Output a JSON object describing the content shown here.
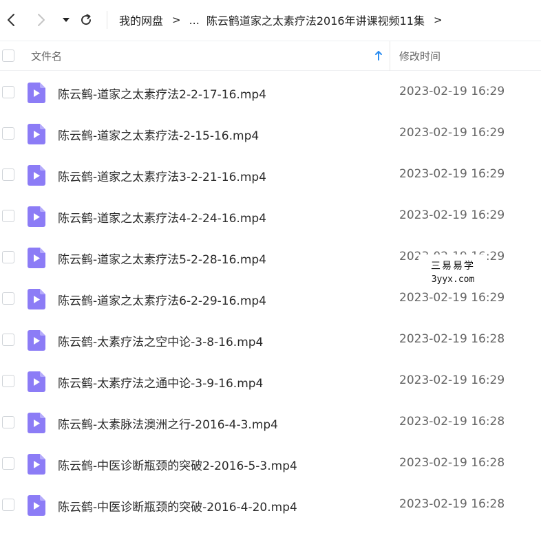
{
  "toolbar": {
    "back_icon": "chevron-left-icon",
    "forward_icon": "chevron-right-icon",
    "dropdown_icon": "caret-down-icon",
    "refresh_icon": "refresh-icon",
    "breadcrumb": {
      "root": "我的网盘",
      "separator": ">",
      "ellipsis": "...",
      "current": "陈云鹤道家之太素疗法2016年讲课视频11集"
    }
  },
  "header": {
    "name_label": "文件名",
    "time_label": "修改时间",
    "sort_icon": "arrow-up-icon",
    "accent_color": "#2a8cf0"
  },
  "file_icon_color": "#8c7cf6",
  "files": [
    {
      "name": "陈云鹤-道家之太素疗法2-2-17-16.mp4",
      "time": "2023-02-19 16:29"
    },
    {
      "name": "陈云鹤-道家之太素疗法-2-15-16.mp4",
      "time": "2023-02-19 16:29"
    },
    {
      "name": "陈云鹤-道家之太素疗法3-2-21-16.mp4",
      "time": "2023-02-19 16:29"
    },
    {
      "name": "陈云鹤-道家之太素疗法4-2-24-16.mp4",
      "time": "2023-02-19 16:29"
    },
    {
      "name": "陈云鹤-道家之太素疗法5-2-28-16.mp4",
      "time": "2023-02-19 16:29"
    },
    {
      "name": "陈云鹤-道家之太素疗法6-2-29-16.mp4",
      "time": "2023-02-19 16:29"
    },
    {
      "name": "陈云鹤-太素疗法之空中论-3-8-16.mp4",
      "time": "2023-02-19 16:28"
    },
    {
      "name": "陈云鹤-太素疗法之通中论-3-9-16.mp4",
      "time": "2023-02-19 16:29"
    },
    {
      "name": "陈云鹤-太素脉法澳洲之行-2016-4-3.mp4",
      "time": "2023-02-19 16:28"
    },
    {
      "name": "陈云鹤-中医诊断瓶颈的突破2-2016-5-3.mp4",
      "time": "2023-02-19 16:28"
    },
    {
      "name": "陈云鹤-中医诊断瓶颈的突破-2016-4-20.mp4",
      "time": "2023-02-19 16:28"
    }
  ],
  "watermark": {
    "line1": "三易易学",
    "line2": "3yyx.com"
  }
}
